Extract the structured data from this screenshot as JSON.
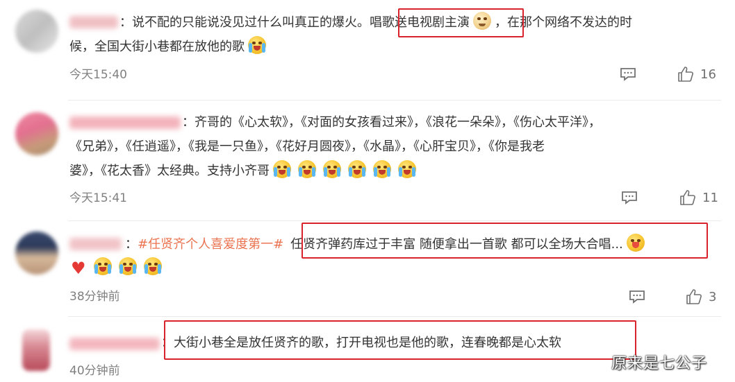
{
  "comments": [
    {
      "text_pre": "：说不配的只能说没见过什么叫真正的爆火。",
      "text_highlight": "唱歌送电视剧主演",
      "text_post": "，在那个网络不发达的时",
      "text_line2": "候，全国大街小巷都在放他的歌",
      "time": "今天15:40",
      "likes": "16"
    },
    {
      "text_line1": "：齐哥的《心太软》，《对面的女孩看过来》，《浪花一朵朵》，《伤心太平洋》，",
      "text_line2": "《兄弟》，《任逍遥》，《我是一只鱼》，《花好月圆夜》，《水晶》，《心肝宝贝》，《你是我老",
      "text_line3": "婆》，《花太香》太经典。支持小齐哥",
      "time": "今天15:41",
      "likes": "11"
    },
    {
      "sep": "：",
      "topic": "#任贤齐个人喜爱度第一#",
      "text_highlight": "任贤齐弹药库过于丰富 随便拿出一首歌 都可以全场大合唱...",
      "time": "38分钟前",
      "likes": "3"
    },
    {
      "sep": "：",
      "text_highlight": "大街小巷全是放任贤齐的歌，打开电视也是他的歌，连春晚都是心太软",
      "time": "40分钟前"
    }
  ],
  "icons": {
    "reply": "comment-icon",
    "like": "thumbs-up-icon",
    "emoji_cry": "crying-laugh-emoji",
    "emoji_dog": "doge-emoji",
    "emoji_tongue": "tongue-out-emoji",
    "heart": "red-heart-emoji"
  },
  "colors": {
    "highlight_border": "#d9222b",
    "topic": "#eb7350",
    "meta": "#808080"
  },
  "watermark": "原来是七公子"
}
